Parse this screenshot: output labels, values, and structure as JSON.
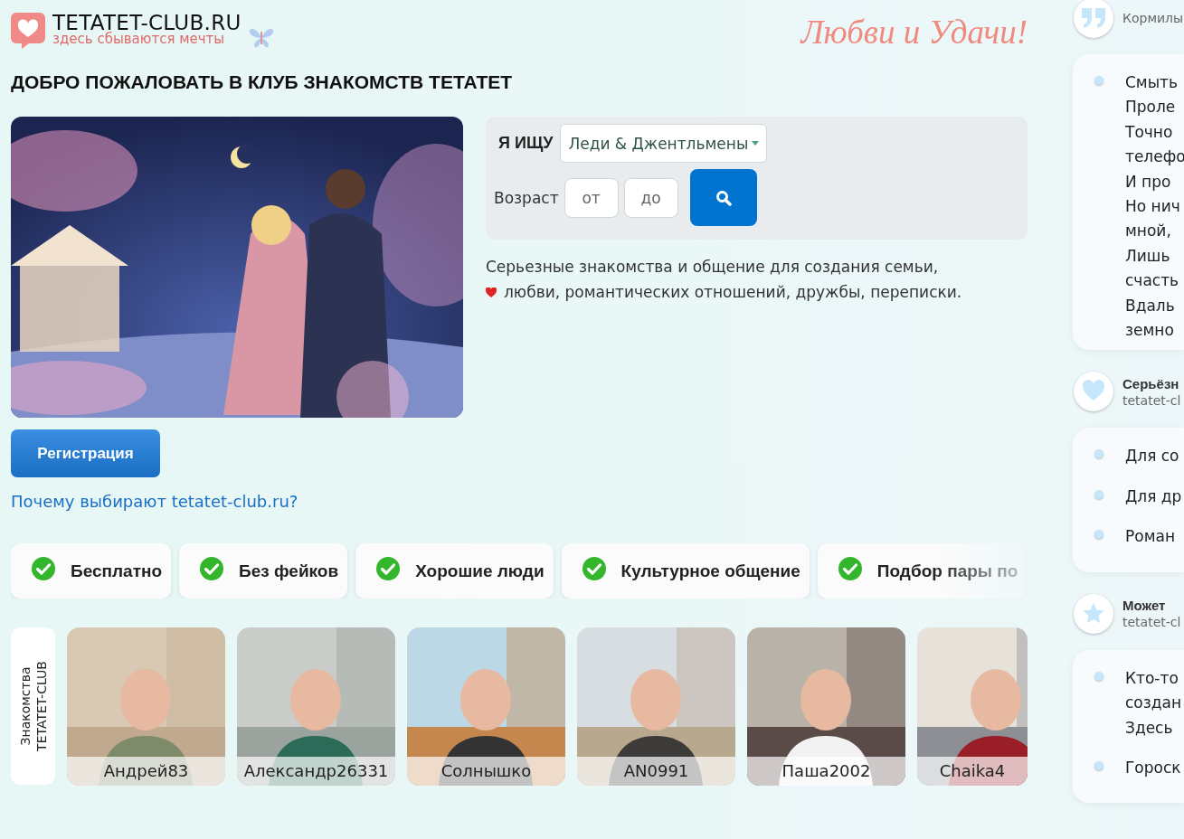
{
  "logo": {
    "title": "TETATET-CLUB.RU",
    "tagline": "здесь сбываются мечты"
  },
  "slogan": "Любви и Удачи!",
  "heading": "ДОБРО ПОЖАЛОВАТЬ В КЛУБ ЗНАКОМСТВ ТЕТАТЕТ",
  "hero": {
    "kind": "picture"
  },
  "search": {
    "seek_label": "Я ИЩУ",
    "seek_value": "Леди & Джентльмены",
    "age_label": "Возраст",
    "from_placeholder": "от",
    "to_placeholder": "до"
  },
  "description": [
    "Серьезные знакомства и общение для создания семьи,",
    "любви, романтических отношений, дружбы, переписки."
  ],
  "register_button": "Регистрация",
  "why_link": "Почему выбирают tetatet-club.ru?",
  "features": [
    "Бесплатно",
    "Без фейков",
    "Хорошие люди",
    "Культурное общение",
    "Подбор пары по"
  ],
  "members_label": [
    "Знакомства",
    "TETATET-CLUB"
  ],
  "profiles": [
    {
      "name": "Андрей83"
    },
    {
      "name": "Александр26331"
    },
    {
      "name": "Солнышко"
    },
    {
      "name": "AN0991"
    },
    {
      "name": "Паша2002"
    },
    {
      "name": "Chaika4"
    }
  ],
  "sidebar": [
    {
      "kind": "quote",
      "subtitle": "Кормилы",
      "lines": [
        "Смыть",
        "Проле",
        "Точно",
        "телефо",
        "И про",
        "Но нич",
        "мной,",
        "Лишь",
        "счасть",
        "Вдаль",
        "земно"
      ]
    },
    {
      "kind": "heart",
      "title": "Серьёзн",
      "subtitle": "tetatet-cl",
      "items": [
        "Для со",
        "Для др",
        "Роман"
      ]
    },
    {
      "kind": "star",
      "title": "Может",
      "subtitle": "tetatet-cl",
      "items": [
        "Кто-то\nсоздан\nЗдесь",
        "Гороск"
      ]
    }
  ]
}
